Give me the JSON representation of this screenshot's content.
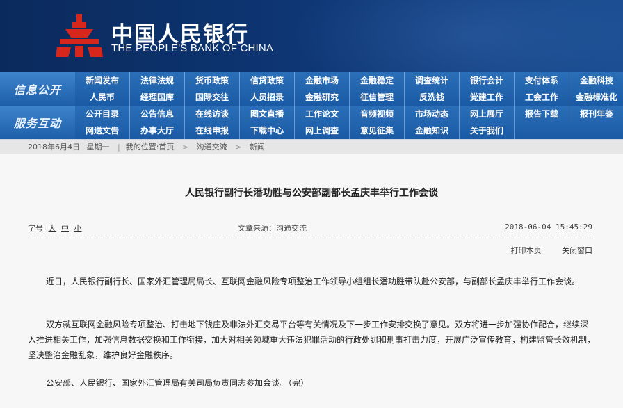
{
  "header": {
    "logo_cn": "中国人民银行",
    "logo_en": "THE PEOPLE'S BANK OF CHINA"
  },
  "nav_info": {
    "title": "信息公开",
    "items": [
      "新闻发布",
      "法律法规",
      "货币政策",
      "信贷政策",
      "金融市场",
      "金融稳定",
      "调查统计",
      "银行会计",
      "支付体系",
      "金融科技",
      "人民币",
      "经理国库",
      "国际交往",
      "人员招录",
      "金融研究",
      "征信管理",
      "反洗钱",
      "党建工作",
      "工会工作",
      "金融标准化"
    ]
  },
  "nav_service": {
    "title": "服务互动",
    "items": [
      "公开目录",
      "公告信息",
      "在线访谈",
      "图文直播",
      "工作论文",
      "音频视频",
      "市场动态",
      "网上展厅",
      "报告下载",
      "报刊年鉴",
      "网送文告",
      "办事大厅",
      "在线申报",
      "下载中心",
      "网上调查",
      "意见征集",
      "金融知识",
      "关于我们"
    ]
  },
  "breadcrumb": {
    "date": "2018年6月4日",
    "weekday": "星期一",
    "location_label": "我的位置:",
    "home": "首页",
    "section": "沟通交流",
    "page": "新闻"
  },
  "article": {
    "title": "人民银行副行长潘功胜与公安部副部长孟庆丰举行工作会谈",
    "font_size_label": "字号",
    "size_large": "大",
    "size_medium": "中",
    "size_small": "小",
    "source": "文章来源：沟通交流",
    "datetime": "2018-06-04  15:45:29",
    "print_label": "打印本页",
    "close_label": "关闭窗口",
    "paragraphs": [
      "近日，人民银行副行长、国家外汇管理局局长、互联网金融风险专项整治工作领导小组组长潘功胜带队赴公安部，与副部长孟庆丰举行工作会谈。",
      "双方就互联网金融风险专项整治、打击地下钱庄及非法外汇交易平台等有关情况及下一步工作安排交换了意见。双方将进一步加强协作配合，继续深入推进相关工作，加强信息数据交换和工作衔接，加大对相关领域重大违法犯罪活动的行政处罚和刑事打击力度，开展广泛宣传教育，构建监管长效机制，坚决整治金融乱象，维护良好金融秩序。",
      "公安部、人民银行、国家外汇管理局有关司局负责同志参加会谈。（完）"
    ]
  },
  "colors": {
    "banner": "#0d3470",
    "nav": "#1a5aa5",
    "emblem_red": "#d7261c"
  }
}
